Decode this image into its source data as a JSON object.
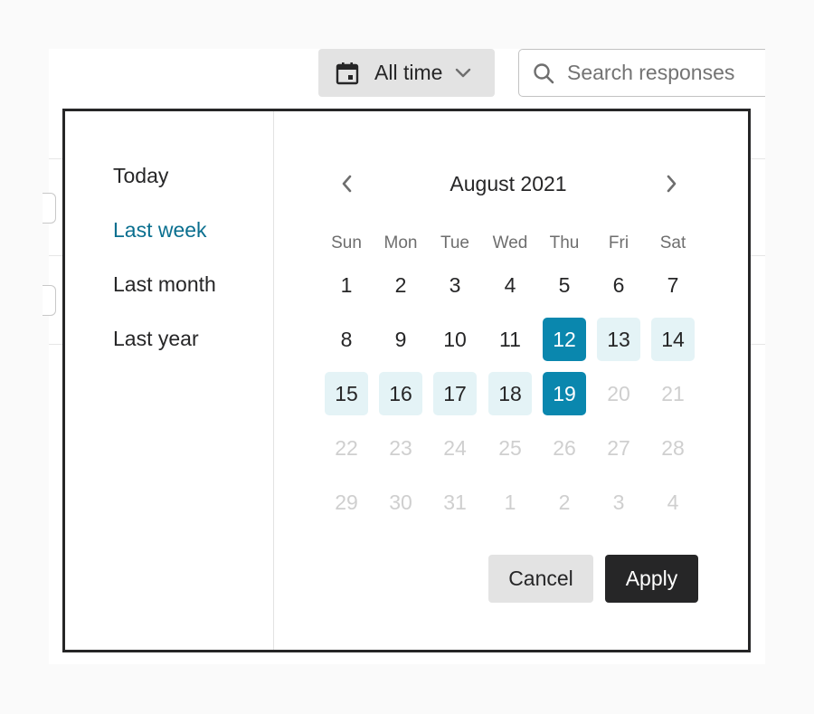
{
  "toolbar": {
    "filter_label": "All time",
    "filter_icon": "calendar-icon",
    "search_placeholder": "Search responses",
    "search_value": ""
  },
  "date_picker": {
    "presets": [
      {
        "label": "Today",
        "active": false
      },
      {
        "label": "Last week",
        "active": true
      },
      {
        "label": "Last month",
        "active": false
      },
      {
        "label": "Last year",
        "active": false
      }
    ],
    "month_label": "August 2021",
    "weekdays": [
      "Sun",
      "Mon",
      "Tue",
      "Wed",
      "Thu",
      "Fri",
      "Sat"
    ],
    "weeks": [
      [
        {
          "d": "1"
        },
        {
          "d": "2"
        },
        {
          "d": "3"
        },
        {
          "d": "4"
        },
        {
          "d": "5"
        },
        {
          "d": "6"
        },
        {
          "d": "7"
        }
      ],
      [
        {
          "d": "8"
        },
        {
          "d": "9"
        },
        {
          "d": "10"
        },
        {
          "d": "11"
        },
        {
          "d": "12",
          "state": "endpoint"
        },
        {
          "d": "13",
          "state": "inrange"
        },
        {
          "d": "14",
          "state": "inrange"
        }
      ],
      [
        {
          "d": "15",
          "state": "inrange"
        },
        {
          "d": "16",
          "state": "inrange"
        },
        {
          "d": "17",
          "state": "inrange"
        },
        {
          "d": "18",
          "state": "inrange"
        },
        {
          "d": "19",
          "state": "endpoint"
        },
        {
          "d": "20",
          "state": "muted"
        },
        {
          "d": "21",
          "state": "muted"
        }
      ],
      [
        {
          "d": "22",
          "state": "muted"
        },
        {
          "d": "23",
          "state": "muted"
        },
        {
          "d": "24",
          "state": "muted"
        },
        {
          "d": "25",
          "state": "muted"
        },
        {
          "d": "26",
          "state": "muted"
        },
        {
          "d": "27",
          "state": "muted"
        },
        {
          "d": "28",
          "state": "muted"
        }
      ],
      [
        {
          "d": "29",
          "state": "muted"
        },
        {
          "d": "30",
          "state": "muted"
        },
        {
          "d": "31",
          "state": "muted"
        },
        {
          "d": "1",
          "state": "muted"
        },
        {
          "d": "2",
          "state": "muted"
        },
        {
          "d": "3",
          "state": "muted"
        },
        {
          "d": "4",
          "state": "muted"
        }
      ]
    ],
    "selected_range": {
      "start": "12",
      "end": "19"
    },
    "cancel_label": "Cancel",
    "apply_label": "Apply"
  },
  "colors": {
    "accent": "#0a87ae",
    "accent_text": "#0a6f8f",
    "range_bg": "#e4f3f6",
    "dark": "#262627"
  }
}
